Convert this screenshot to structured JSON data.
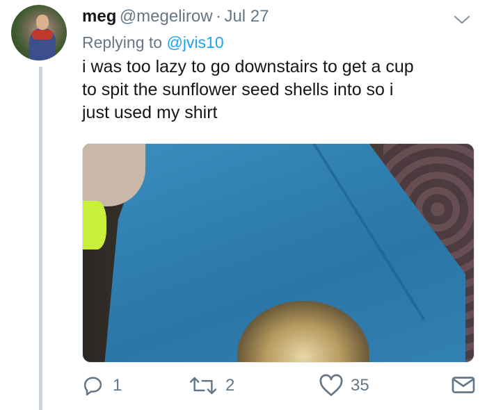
{
  "tweet": {
    "display_name": "meg",
    "handle": "@megelirow",
    "separator": "·",
    "date": "Jul 27",
    "replying_prefix": "Replying to",
    "replying_to": "@jvis10",
    "text_lines": [
      "i was too lazy to go downstairs to get a cup",
      "to spit the sunflower seed shells into so i",
      "just used my shirt"
    ]
  },
  "actions": {
    "reply_count": "1",
    "retweet_count": "2",
    "like_count": "35"
  },
  "icons": {
    "reply": "reply-icon",
    "retweet": "retweet-icon",
    "like": "heart-icon",
    "dm": "envelope-icon",
    "menu": "chevron-down-icon"
  },
  "colors": {
    "text": "#14171a",
    "muted": "#657786",
    "link": "#1da1f2",
    "thread_line": "#cdd5dc"
  }
}
